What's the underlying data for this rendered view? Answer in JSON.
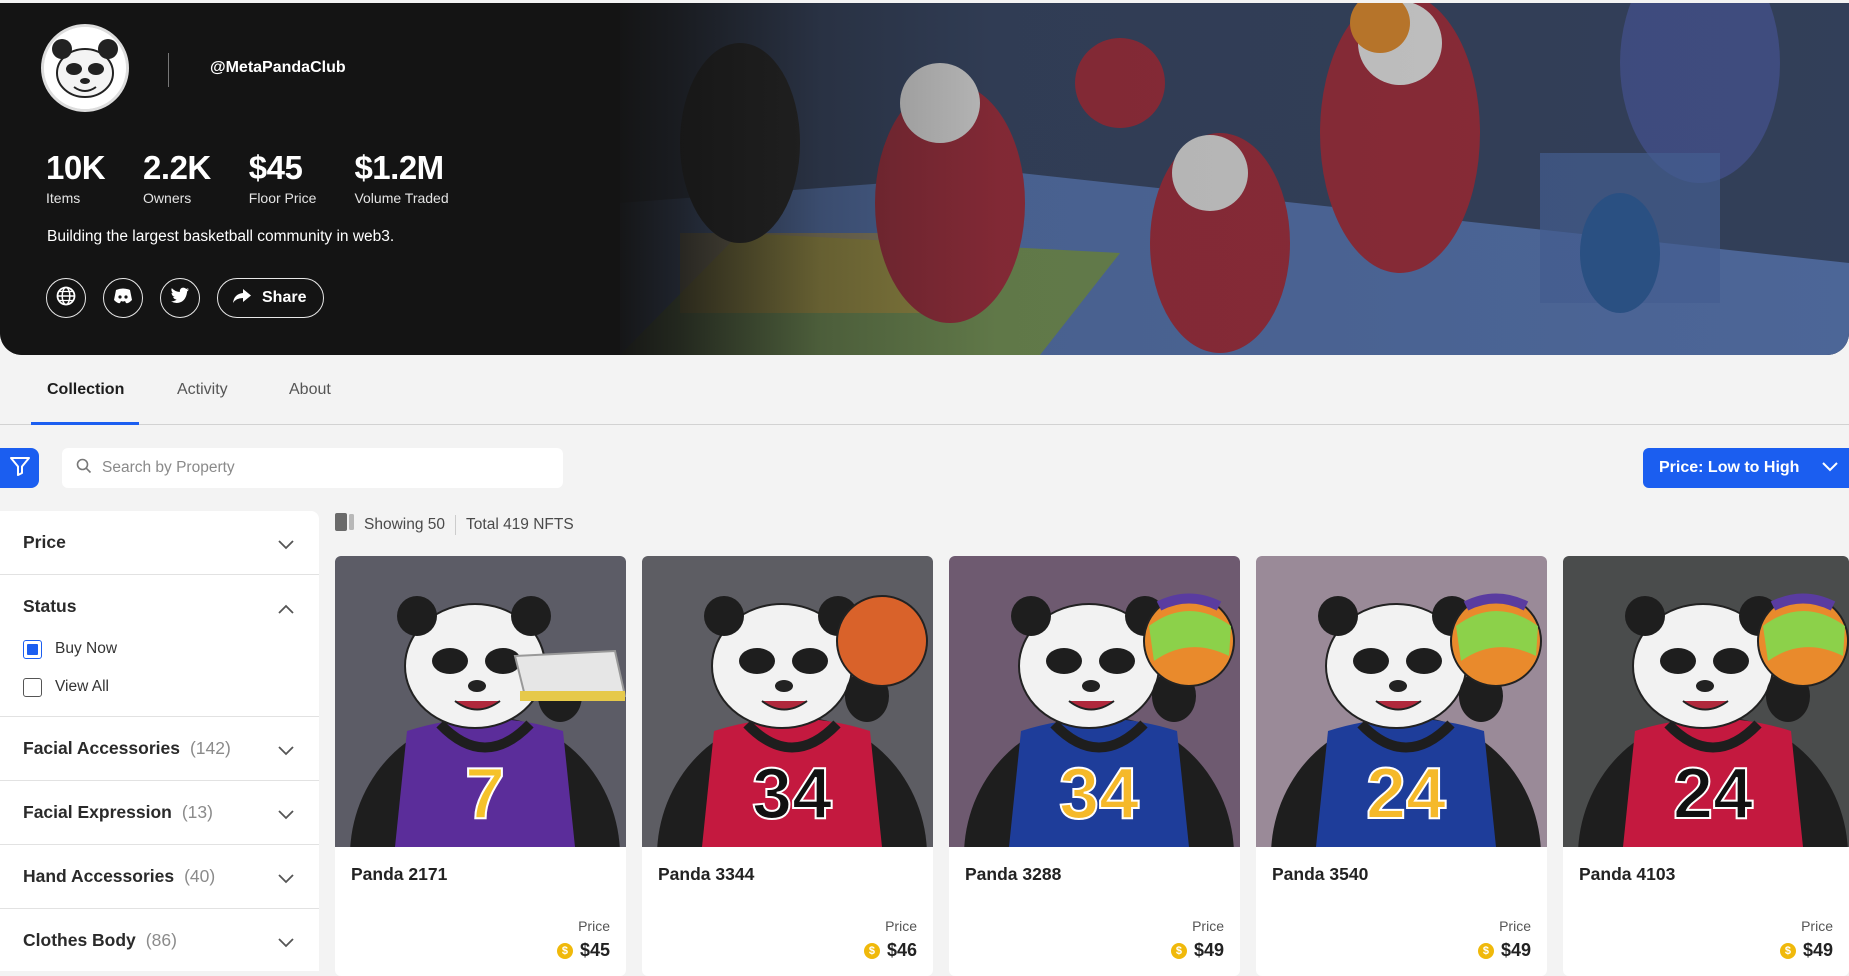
{
  "profile": {
    "handle": "@MetaPandaClub",
    "description": "Building the largest basketball community in web3."
  },
  "stats": [
    {
      "value": "10K",
      "label": "Items"
    },
    {
      "value": "2.2K",
      "label": "Owners"
    },
    {
      "value": "$45",
      "label": "Floor Price"
    },
    {
      "value": "$1.2M",
      "label": "Volume Traded"
    }
  ],
  "social": {
    "share_label": "Share",
    "icons": [
      "globe-icon",
      "discord-icon",
      "twitter-icon",
      "share-icon"
    ]
  },
  "tabs": [
    {
      "label": "Collection",
      "active": true
    },
    {
      "label": "Activity",
      "active": false
    },
    {
      "label": "About",
      "active": false
    }
  ],
  "search": {
    "placeholder": "Search by Property"
  },
  "sort": {
    "label": "Price: Low to High"
  },
  "filters": {
    "price": {
      "label": "Price"
    },
    "status": {
      "label": "Status",
      "options": [
        {
          "label": "Buy Now",
          "checked": true
        },
        {
          "label": "View All",
          "checked": false
        }
      ]
    },
    "facial_accessories": {
      "label": "Facial Accessories",
      "count": "(142)"
    },
    "facial_expression": {
      "label": "Facial Expression",
      "count": "(13)"
    },
    "hand_accessories": {
      "label": "Hand Accessories",
      "count": "(40)"
    },
    "clothes_body": {
      "label": "Clothes Body",
      "count": "(86)"
    }
  },
  "results": {
    "showing": "Showing 50",
    "total": "Total 419 NFTS"
  },
  "cards": [
    {
      "name": "Panda 2171",
      "price_label": "Price",
      "price": "$45",
      "bg": "#5c5c66",
      "jersey": "#5b2d9a",
      "number": "7",
      "num_color": "#f5c22a"
    },
    {
      "name": "Panda 3344",
      "price_label": "Price",
      "price": "$46",
      "bg": "#5d5d63",
      "jersey": "#c4193f",
      "number": "34",
      "num_color": "#111111"
    },
    {
      "name": "Panda 3288",
      "price_label": "Price",
      "price": "$49",
      "bg": "#6e5a70",
      "jersey": "#1e3d9a",
      "number": "34",
      "num_color": "#f5b92a"
    },
    {
      "name": "Panda 3540",
      "price_label": "Price",
      "price": "$49",
      "bg": "#9a8a98",
      "jersey": "#1e3d9a",
      "number": "24",
      "num_color": "#f5b92a"
    },
    {
      "name": "Panda 4103",
      "price_label": "Price",
      "price": "$49",
      "bg": "#4a4c4c",
      "jersey": "#c4193f",
      "number": "24",
      "num_color": "#111111"
    }
  ],
  "colors": {
    "accent": "#1b5ef0",
    "hero_bg": "#141414",
    "coin": "#f0b90b"
  }
}
